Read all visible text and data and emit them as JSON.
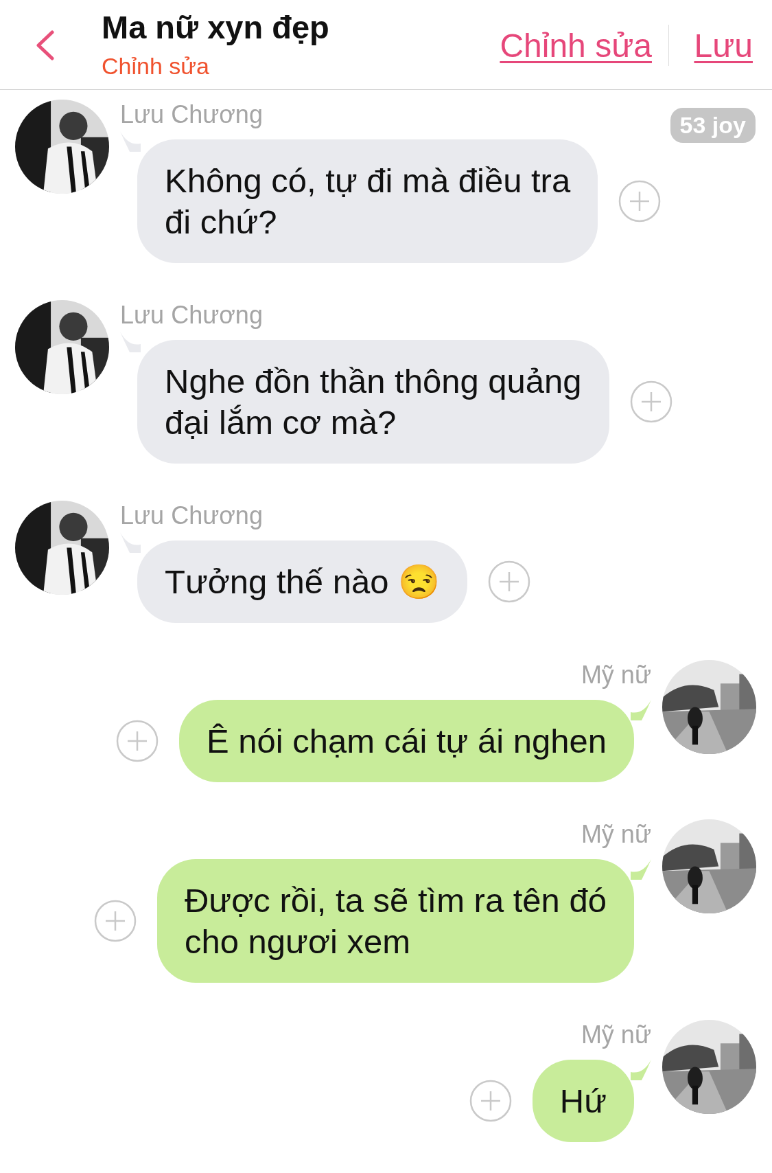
{
  "header": {
    "title": "Ma nữ xyn đẹp",
    "subtitle": "Chỉnh sửa",
    "actions": [
      "Chỉnh sửa",
      "Lưu"
    ]
  },
  "badge": "53 joy",
  "messages": [
    {
      "kind": "incoming",
      "sender": "Lưu Chương",
      "lines": [
        "Không có, tự đi mà điều tra",
        "đi chứ?"
      ]
    },
    {
      "kind": "incoming",
      "sender": "Lưu Chương",
      "lines": [
        "Nghe đồn thần thông quảng",
        "đại lắm cơ mà?"
      ]
    },
    {
      "kind": "incoming",
      "sender": "Lưu Chương",
      "lines": [
        "Tưởng thế nào 😒"
      ]
    },
    {
      "kind": "outgoing",
      "sender": "Mỹ nữ",
      "lines": [
        "Ê nói chạm cái tự ái nghen"
      ]
    },
    {
      "kind": "outgoing",
      "sender": "Mỹ nữ",
      "lines": [
        "Được rồi, ta sẽ tìm ra tên đó",
        "cho ngươi xem"
      ]
    },
    {
      "kind": "outgoing",
      "sender": "Mỹ nữ",
      "lines": [
        "Hứ"
      ]
    }
  ]
}
